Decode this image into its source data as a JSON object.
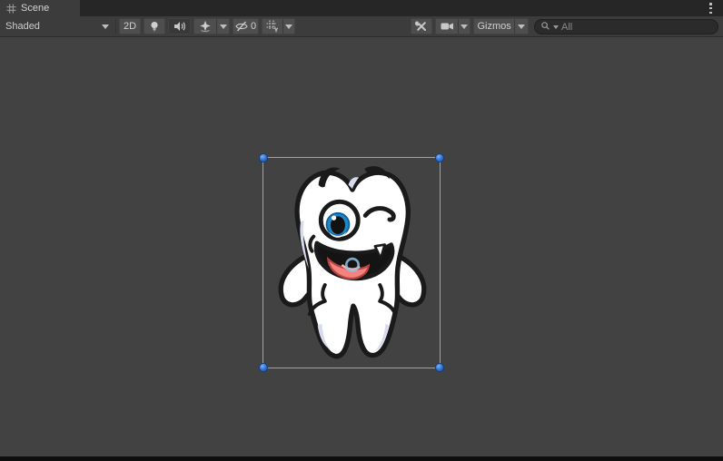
{
  "tab": {
    "label": "Scene",
    "icon": "grid-icon"
  },
  "window_menu": {
    "icon": "vertical-ellipsis-icon"
  },
  "toolbar": {
    "shading_mode": "Shaded",
    "mode_2d": "2D",
    "lighting_icon": "light-bulb-icon",
    "audio_icon": "audio-speaker-icon",
    "effects_icon": "effects-star-icon",
    "visibility_icon": "hidden-eye-icon",
    "visibility_count": "0",
    "grid_icon": "grid-y-axis-icon",
    "tools_icon": "tools-icon",
    "camera_icon": "camera-icon",
    "gizmos": "Gizmos",
    "search_icon": "magnifier-icon",
    "search_placeholder": "All"
  },
  "scene_view": {
    "selected_object": "tooth-character-sprite",
    "selection_outline_color": "#A2A2A2",
    "selection_handle_color": "#2F6FD2",
    "background_color": "#424242"
  }
}
